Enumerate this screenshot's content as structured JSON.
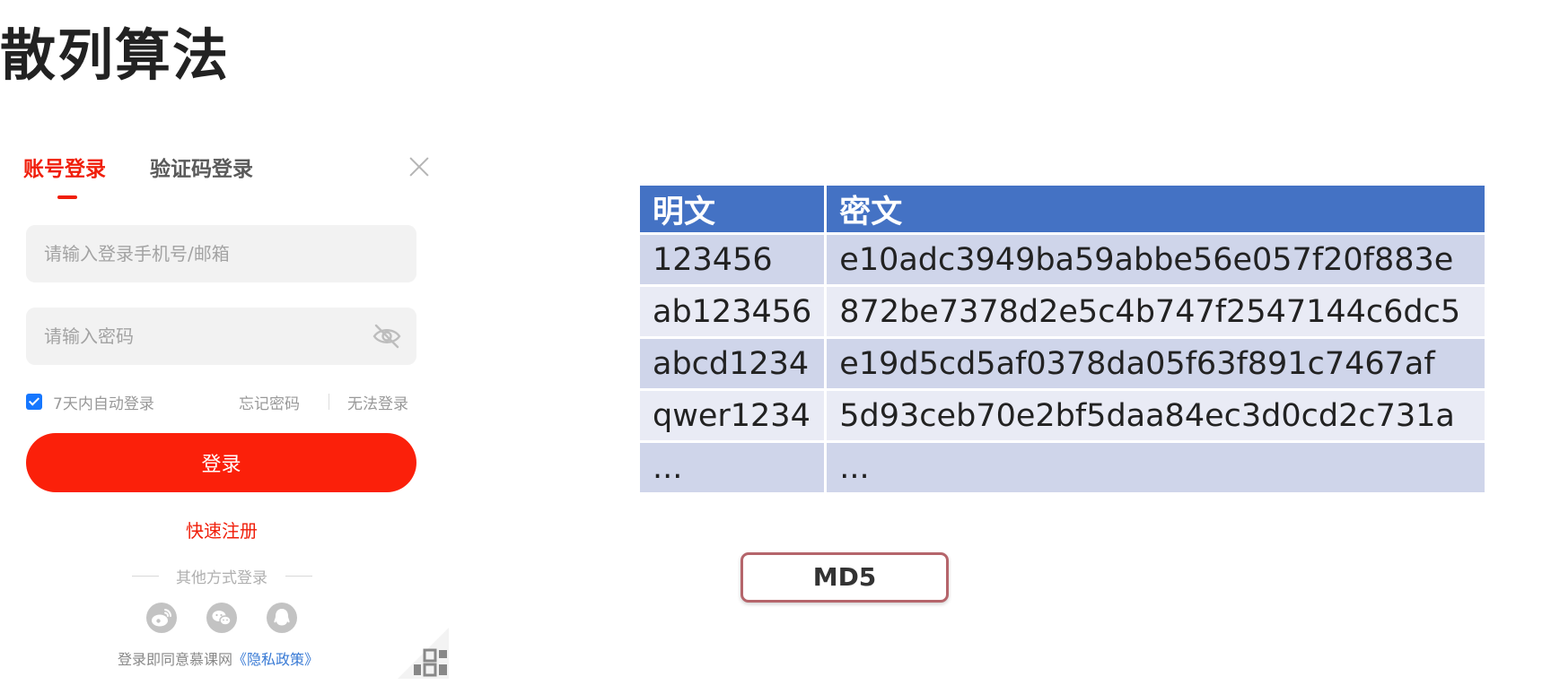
{
  "slide": {
    "title": "散列算法"
  },
  "login": {
    "tabs": [
      {
        "label": "账号登录",
        "active": true
      },
      {
        "label": "验证码登录",
        "active": false
      }
    ],
    "username_placeholder": "请输入登录手机号/邮箱",
    "password_placeholder": "请输入密码",
    "remember_label": "7天内自动登录",
    "remember_checked": true,
    "forgot_label": "忘记密码",
    "cannot_login_label": "无法登录",
    "submit_label": "登录",
    "register_label": "快速注册",
    "other_methods_label": "其他方式登录",
    "social_icons": [
      "weibo-icon",
      "wechat-icon",
      "qq-icon"
    ],
    "agreement_text": "登录即同意慕课网",
    "privacy_link": "《隐私政策》",
    "accent_color": "#f01e0a"
  },
  "table": {
    "headers": [
      "明文",
      "密文"
    ],
    "rows": [
      [
        "123456",
        "e10adc3949ba59abbe56e057f20f883e"
      ],
      [
        "ab123456",
        "872be7378d2e5c4b747f2547144c6dc5"
      ],
      [
        "abcd1234",
        "e19d5cd5af0378da05f63f891c7467af"
      ],
      [
        "qwer1234",
        "5d93ceb70e2bf5daa84ec3d0cd2c731a"
      ],
      [
        "...",
        "..."
      ]
    ],
    "header_color": "#4472c4"
  },
  "algorithm_label": "MD5"
}
